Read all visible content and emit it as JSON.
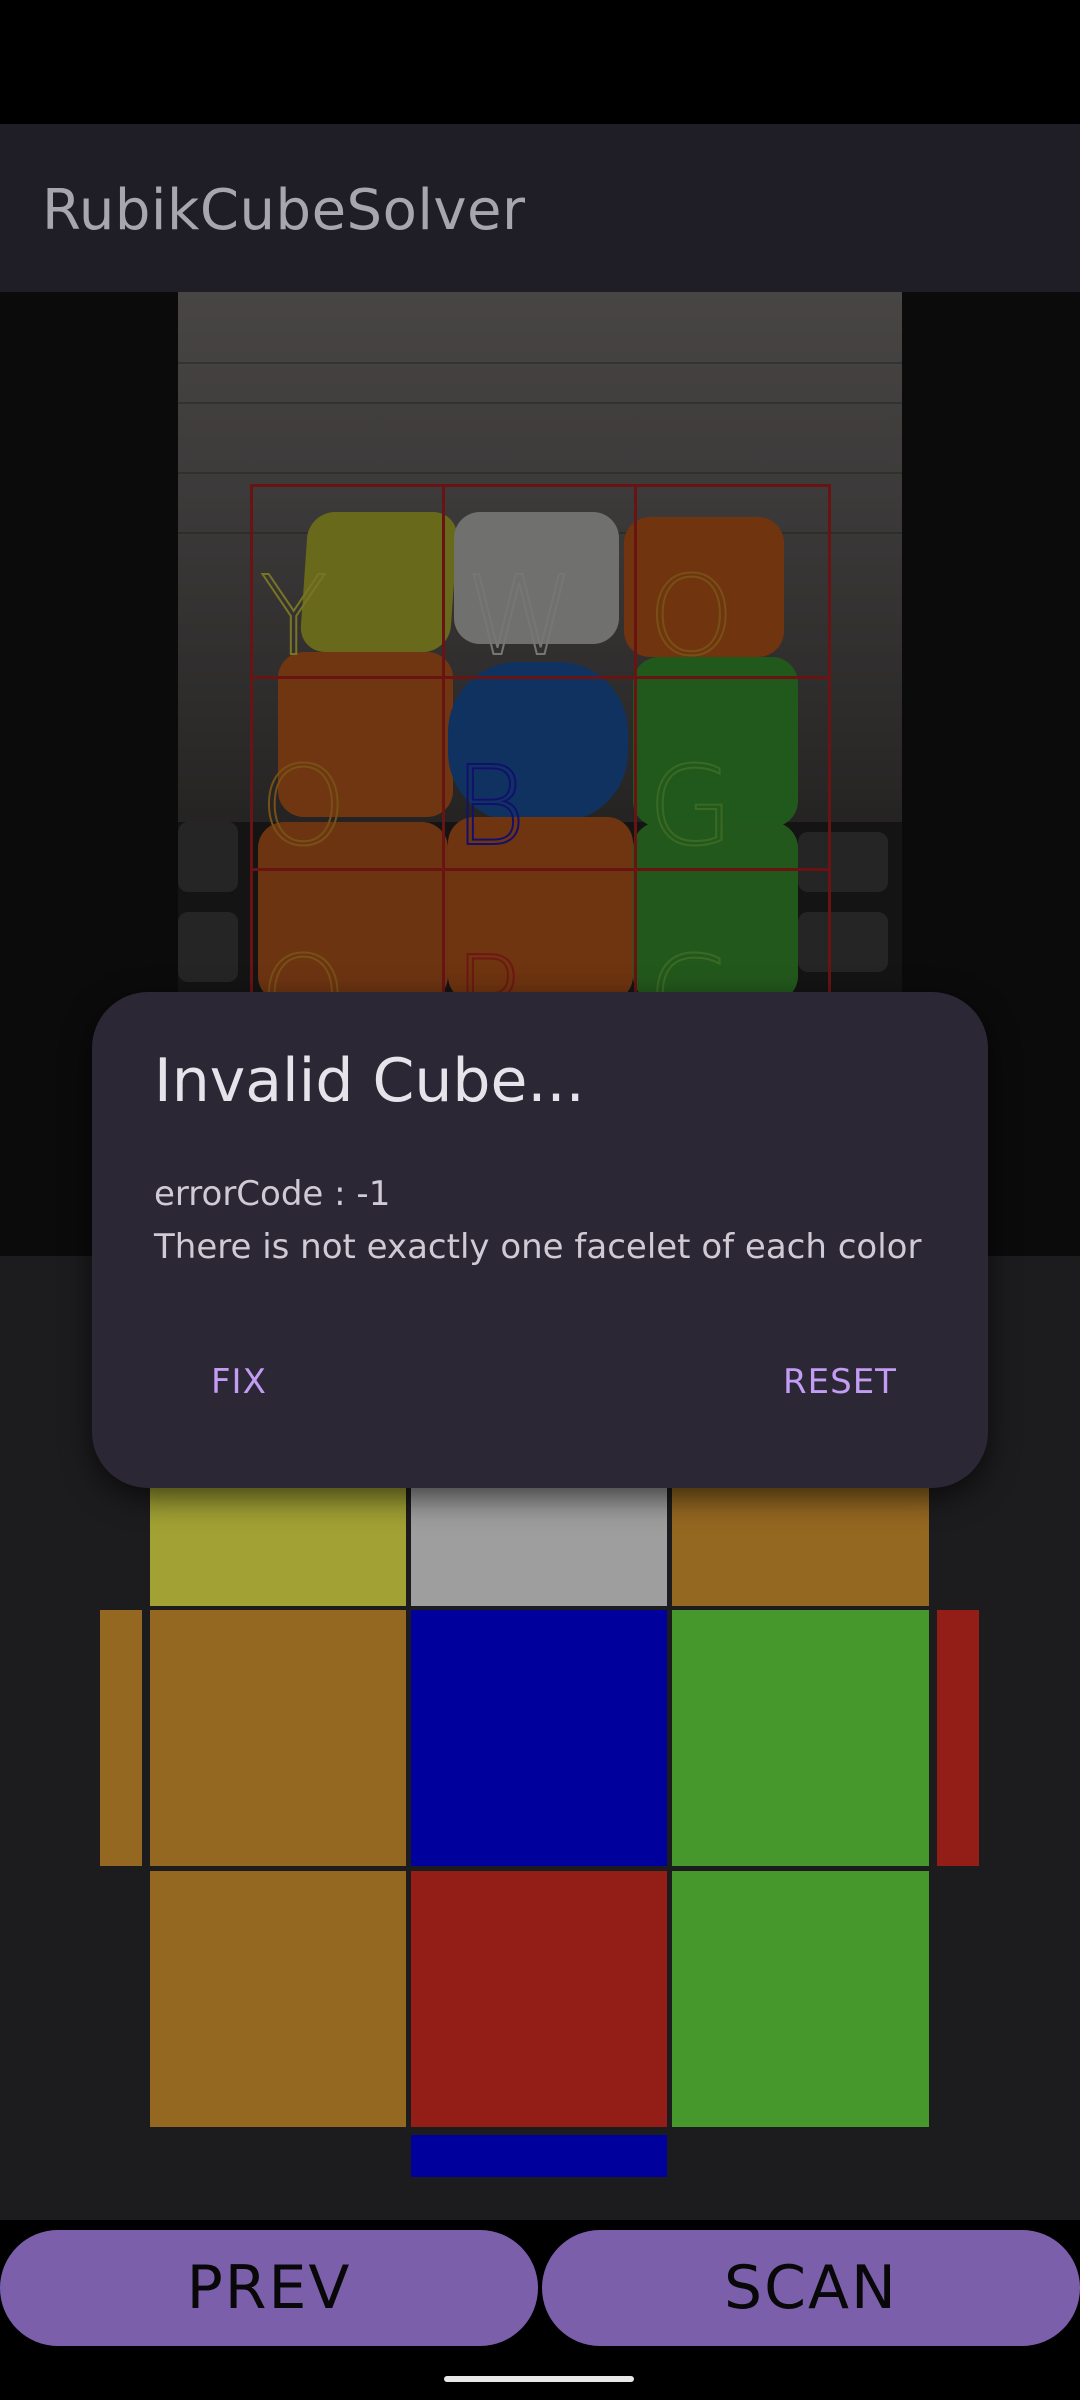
{
  "app": {
    "title": "RubikCubeSolver"
  },
  "camera": {
    "grid_letters": [
      "Y",
      "W",
      "O",
      "O",
      "B",
      "G",
      "O",
      "R",
      "G"
    ],
    "letter_colors": [
      "#b9b23a",
      "#b5b5b5",
      "#b77b23",
      "#b77b23",
      "#1d1aa8",
      "#5aa23a",
      "#b77b23",
      "#a8261e",
      "#5aa23a"
    ]
  },
  "dialog": {
    "title": "Invalid Cube...",
    "message_line1": "errorCode : -1",
    "message_line2": "There is not exactly one facelet of each color",
    "fix_label": "FIX",
    "reset_label": "RESET"
  },
  "cube_face": {
    "colors": {
      "yellow": "#b3b33a",
      "white": "#b0b0b0",
      "orange": "#a67425",
      "blue": "#0000ae",
      "green": "#4ea932",
      "red": "#a3211b"
    },
    "rows": [
      [
        "yellow",
        "white",
        "orange"
      ],
      [
        "orange",
        "blue",
        "green"
      ],
      [
        "orange",
        "red",
        "green"
      ]
    ],
    "left_edge": "orange",
    "right_edge": "red",
    "bottom_edge": "blue"
  },
  "buttons": {
    "prev_label": "PREV",
    "scan_label": "SCAN"
  }
}
